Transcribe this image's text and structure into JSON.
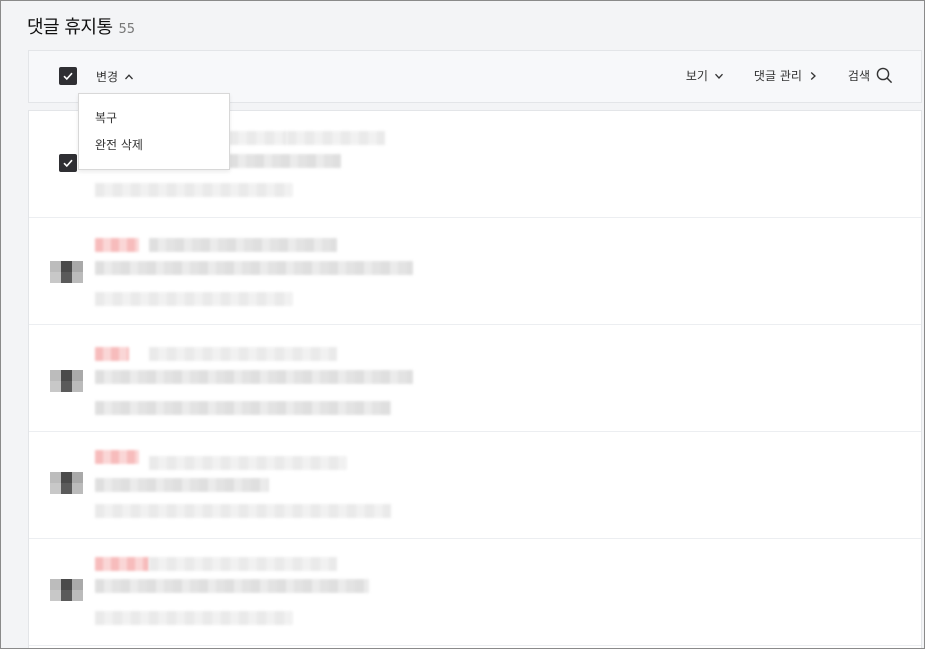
{
  "header": {
    "title": "댓글 휴지통",
    "count": "55"
  },
  "toolbar": {
    "change_label": "변경",
    "view_label": "보기",
    "manage_label": "댓글 관리",
    "search_label": "검색"
  },
  "dropdown": {
    "items": [
      "복구",
      "완전 삭제"
    ]
  },
  "list": {
    "rows": [
      {
        "checked": true
      },
      {
        "checked": false
      },
      {
        "checked": false
      },
      {
        "checked": false
      },
      {
        "checked": false
      }
    ]
  }
}
